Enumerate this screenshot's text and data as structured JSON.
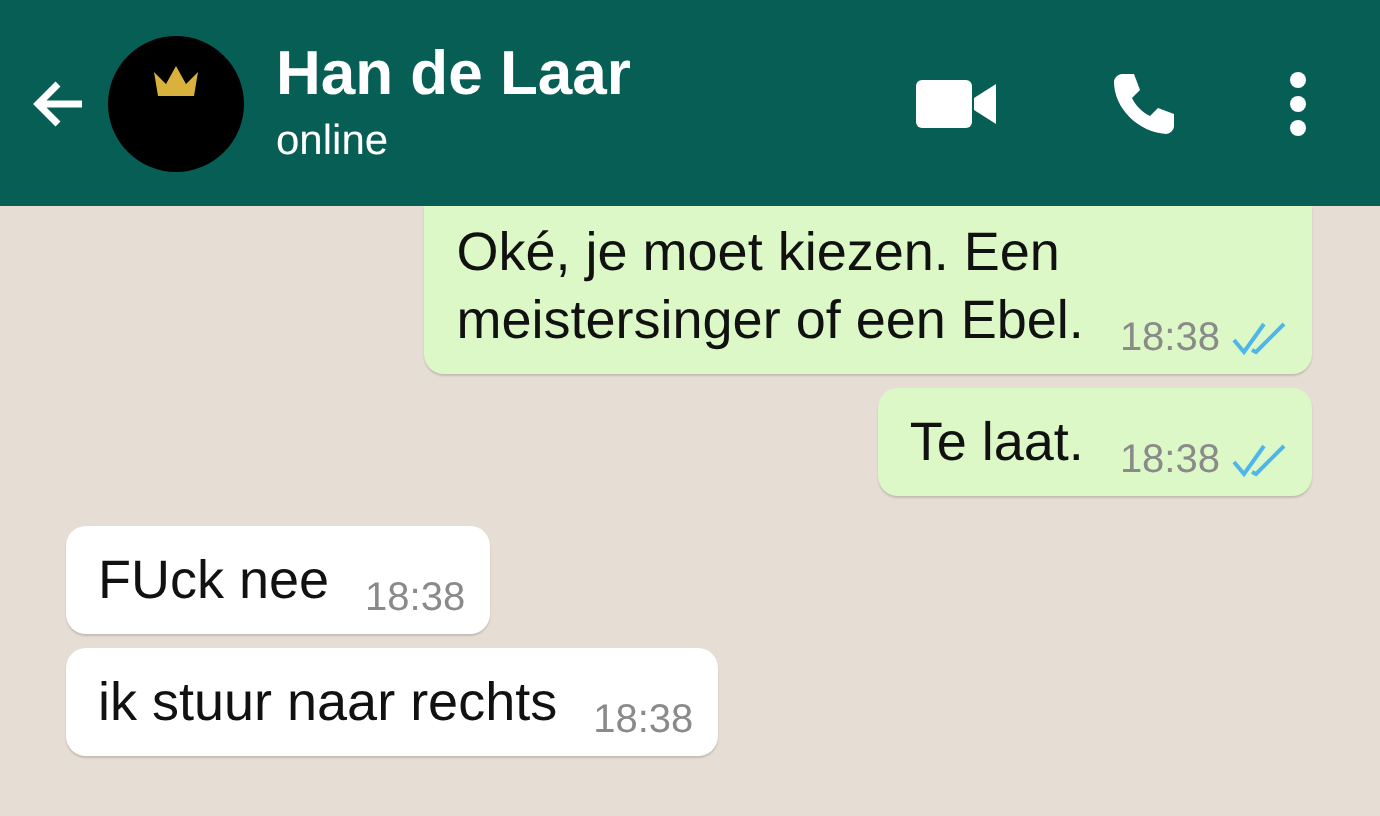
{
  "header": {
    "name": "Han de Laar",
    "status": "online"
  },
  "messages": [
    {
      "kind": "outgoing",
      "text": "Oké, je moet kiezen. Een\nmeistersinger of een Ebel.",
      "time": "18:38",
      "read": true
    },
    {
      "kind": "outgoing",
      "text": "Te laat.",
      "time": "18:38",
      "read": true
    },
    {
      "kind": "incoming",
      "text": "FUck nee",
      "time": "18:38"
    },
    {
      "kind": "incoming",
      "text": "ik stuur naar rechts",
      "time": "18:38"
    }
  ]
}
